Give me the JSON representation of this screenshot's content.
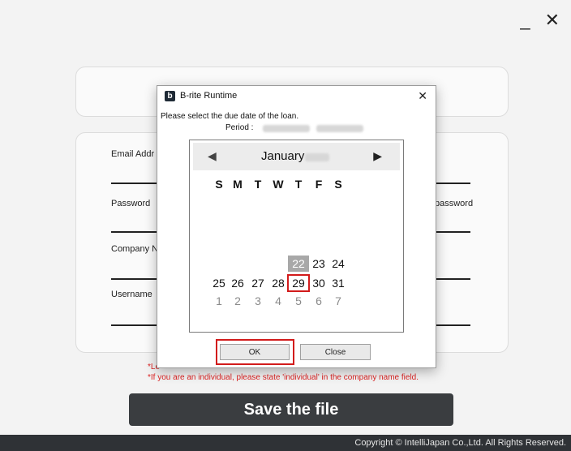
{
  "window": {
    "minimize_glyph": "_",
    "close_glyph": "✕"
  },
  "form": {
    "email_label": "Email Addr",
    "password_label": "Password",
    "confirm_password_label": "password",
    "company_label": "Company N",
    "username_label": "Username"
  },
  "warnings": {
    "line1": "*Le",
    "line2": "*If you are an individual, please state 'individual' in the company name field."
  },
  "save_button": "Save the file",
  "footer": "Copyright ©  IntelliJapan Co.,Ltd.  All Rights Reserved.",
  "dialog": {
    "app_icon_letter": "b",
    "title": "B-rite Runtime",
    "close_glyph": "✕",
    "prompt": "Please select the due date of the loan.",
    "period_label": "Period  :",
    "ok": "OK",
    "close_button": "Close"
  },
  "calendar": {
    "month": "January",
    "prev_glyph": "◀",
    "next_glyph": "▶",
    "weekdays": [
      "S",
      "M",
      "T",
      "W",
      "T",
      "F",
      "S"
    ],
    "weeks": [
      [
        "",
        "",
        "",
        "",
        "22",
        "23",
        "24"
      ],
      [
        "25",
        "26",
        "27",
        "28",
        "29",
        "30",
        "31"
      ],
      [
        "1",
        "2",
        "3",
        "4",
        "5",
        "6",
        "7"
      ]
    ],
    "today_day": "22",
    "selected_day": "29"
  }
}
